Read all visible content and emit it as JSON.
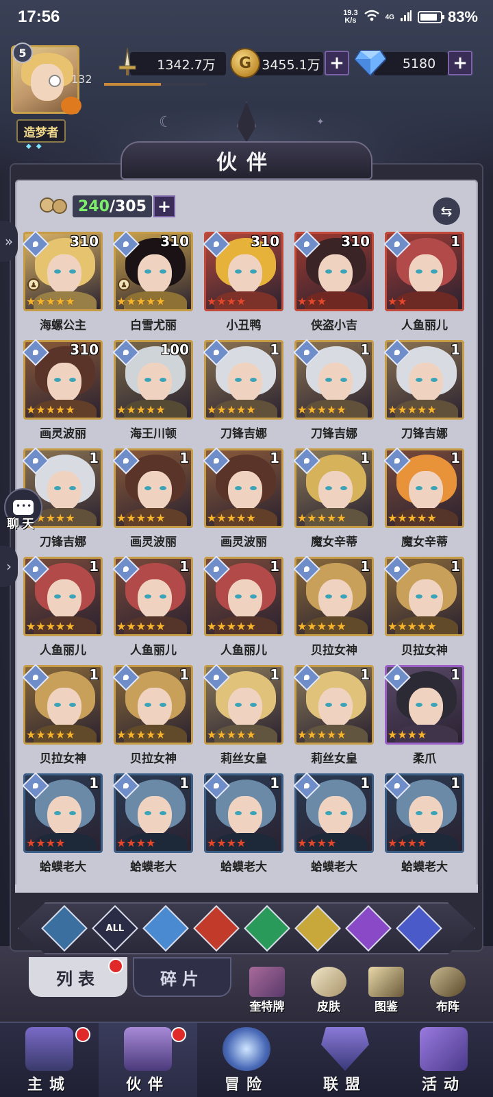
{
  "status_bar": {
    "time": "17:56",
    "net_speed_value": "19.3",
    "net_speed_unit": "K/s",
    "network": "4G",
    "battery": "83%"
  },
  "player": {
    "level": "5",
    "title": "造梦者",
    "power_value": "132",
    "exp_fraction": 0.55
  },
  "resources": {
    "combat_power": "1342.7万",
    "gold": "3455.1万",
    "gems": "5180"
  },
  "panel": {
    "title": "伙伴",
    "owned": "240",
    "capacity": "/305"
  },
  "heroes": [
    {
      "name": "海螺公主",
      "level": "310",
      "stars": 5,
      "star_color": "gold",
      "frame": "gold",
      "bg": "#d9b466",
      "hair": "#e6c46f",
      "chess": true
    },
    {
      "name": "白雪尤丽",
      "level": "310",
      "stars": 5,
      "star_color": "gold",
      "frame": "gold",
      "bg": "#c9a24c",
      "hair": "#1a1214",
      "chess": true
    },
    {
      "name": "小丑鸭",
      "level": "310",
      "stars": 4,
      "star_color": "red",
      "frame": "red",
      "bg": "#b3473a",
      "hair": "#e6b23a",
      "chess": false
    },
    {
      "name": "侠盗小吉",
      "level": "310",
      "stars": 3,
      "star_color": "red",
      "frame": "red",
      "bg": "#a03a30",
      "hair": "#3a2426",
      "chess": false
    },
    {
      "name": "人鱼丽儿",
      "level": "1",
      "stars": 2,
      "star_color": "red",
      "frame": "red",
      "bg": "#9c3a34",
      "hair": "#b24a4a",
      "chess": false
    },
    {
      "name": "画灵波丽",
      "level": "310",
      "stars": 5,
      "star_color": "gold",
      "frame": "gold",
      "bg": "#8a5a3a",
      "hair": "#5a3428",
      "chess": false
    },
    {
      "name": "海王川顿",
      "level": "100",
      "stars": 5,
      "star_color": "gold",
      "frame": "gold",
      "bg": "#7a6a4a",
      "hair": "#cfd4d8",
      "chess": false
    },
    {
      "name": "刀锋吉娜",
      "level": "1",
      "stars": 5,
      "star_color": "gold",
      "frame": "gold",
      "bg": "#8b7454",
      "hair": "#d8dce2",
      "chess": false
    },
    {
      "name": "刀锋吉娜",
      "level": "1",
      "stars": 5,
      "star_color": "gold",
      "frame": "gold",
      "bg": "#8b7454",
      "hair": "#d8dce2",
      "chess": false
    },
    {
      "name": "刀锋吉娜",
      "level": "1",
      "stars": 5,
      "star_color": "gold",
      "frame": "gold",
      "bg": "#8b7454",
      "hair": "#d8dce2",
      "chess": false
    },
    {
      "name": "刀锋吉娜",
      "level": "1",
      "stars": 5,
      "star_color": "gold",
      "frame": "gold",
      "bg": "#8b7454",
      "hair": "#d8dce2",
      "chess": false
    },
    {
      "name": "画灵波丽",
      "level": "1",
      "stars": 5,
      "star_color": "gold",
      "frame": "gold",
      "bg": "#8a5a3a",
      "hair": "#5a3428",
      "chess": false
    },
    {
      "name": "画灵波丽",
      "level": "1",
      "stars": 5,
      "star_color": "gold",
      "frame": "gold",
      "bg": "#8a5a3a",
      "hair": "#5a3428",
      "chess": false
    },
    {
      "name": "魔女辛蒂",
      "level": "1",
      "stars": 5,
      "star_color": "gold",
      "frame": "gold",
      "bg": "#8a7a5a",
      "hair": "#d6b25a",
      "chess": false
    },
    {
      "name": "魔女辛蒂",
      "level": "1",
      "stars": 5,
      "star_color": "gold",
      "frame": "gold",
      "bg": "#7a4a3a",
      "hair": "#e8923a",
      "chess": false
    },
    {
      "name": "人鱼丽儿",
      "level": "1",
      "stars": 5,
      "star_color": "gold",
      "frame": "gold",
      "bg": "#7a4a3a",
      "hair": "#b24a4a",
      "chess": false
    },
    {
      "name": "人鱼丽儿",
      "level": "1",
      "stars": 5,
      "star_color": "gold",
      "frame": "gold",
      "bg": "#7a4a3a",
      "hair": "#b24a4a",
      "chess": false
    },
    {
      "name": "人鱼丽儿",
      "level": "1",
      "stars": 5,
      "star_color": "gold",
      "frame": "gold",
      "bg": "#7a4a3a",
      "hair": "#b24a4a",
      "chess": false
    },
    {
      "name": "贝拉女神",
      "level": "1",
      "stars": 5,
      "star_color": "gold",
      "frame": "gold",
      "bg": "#8a6a3a",
      "hair": "#c8a05a",
      "chess": false
    },
    {
      "name": "贝拉女神",
      "level": "1",
      "stars": 5,
      "star_color": "gold",
      "frame": "gold",
      "bg": "#8a6a3a",
      "hair": "#c8a05a",
      "chess": false
    },
    {
      "name": "贝拉女神",
      "level": "1",
      "stars": 5,
      "star_color": "gold",
      "frame": "gold",
      "bg": "#8a6a3a",
      "hair": "#c8a05a",
      "chess": false
    },
    {
      "name": "贝拉女神",
      "level": "1",
      "stars": 5,
      "star_color": "gold",
      "frame": "gold",
      "bg": "#8a6a3a",
      "hair": "#c8a05a",
      "chess": false
    },
    {
      "name": "莉丝女皇",
      "level": "1",
      "stars": 5,
      "star_color": "gold",
      "frame": "gold",
      "bg": "#8a7a5a",
      "hair": "#e0c27a",
      "chess": false
    },
    {
      "name": "莉丝女皇",
      "level": "1",
      "stars": 5,
      "star_color": "gold",
      "frame": "gold",
      "bg": "#8a7a5a",
      "hair": "#e0c27a",
      "chess": false
    },
    {
      "name": "柔爪",
      "level": "1",
      "stars": 4,
      "star_color": "gold",
      "frame": "purple",
      "bg": "#5a4a6a",
      "hair": "#2c2a34",
      "chess": false
    },
    {
      "name": "蛤蟆老大",
      "level": "1",
      "stars": 4,
      "star_color": "red",
      "frame": "blue",
      "bg": "#2a3a52",
      "hair": "#6a8aa8",
      "chess": false
    },
    {
      "name": "蛤蟆老大",
      "level": "1",
      "stars": 4,
      "star_color": "red",
      "frame": "blue",
      "bg": "#2a3a52",
      "hair": "#6a8aa8",
      "chess": false
    },
    {
      "name": "蛤蟆老大",
      "level": "1",
      "stars": 4,
      "star_color": "red",
      "frame": "blue",
      "bg": "#2a3a52",
      "hair": "#6a8aa8",
      "chess": false
    },
    {
      "name": "蛤蟆老大",
      "level": "1",
      "stars": 4,
      "star_color": "red",
      "frame": "blue",
      "bg": "#2a3a52",
      "hair": "#6a8aa8",
      "chess": false
    },
    {
      "name": "蛤蟆老大",
      "level": "1",
      "stars": 4,
      "star_color": "red",
      "frame": "blue",
      "bg": "#2a3a52",
      "hair": "#6a8aa8",
      "chess": false
    }
  ],
  "filters": [
    {
      "name": "filter-default",
      "label": "",
      "color": "#3a6fa0"
    },
    {
      "name": "filter-all",
      "label": "ALL",
      "color": "#2a2b44"
    },
    {
      "name": "filter-water",
      "label": "",
      "color": "#4a8ad0"
    },
    {
      "name": "filter-fire",
      "label": "",
      "color": "#c23a2a"
    },
    {
      "name": "filter-wind",
      "label": "",
      "color": "#2a9a5a"
    },
    {
      "name": "filter-light",
      "label": "",
      "color": "#c8a83a"
    },
    {
      "name": "filter-moon",
      "label": "",
      "color": "#8a4ac8"
    },
    {
      "name": "filter-planet",
      "label": "",
      "color": "#4a5ac8"
    }
  ],
  "tabs": {
    "list": "列表",
    "shards": "碎片"
  },
  "quick_actions": {
    "tarot": "奎特牌",
    "skin": "皮肤",
    "codex": "图鉴",
    "formation": "布阵"
  },
  "chat": {
    "label": "聊天"
  },
  "bottom_nav": {
    "town": "主城",
    "partners": "伙伴",
    "adventure": "冒险",
    "guild": "联盟",
    "events": "活动"
  }
}
